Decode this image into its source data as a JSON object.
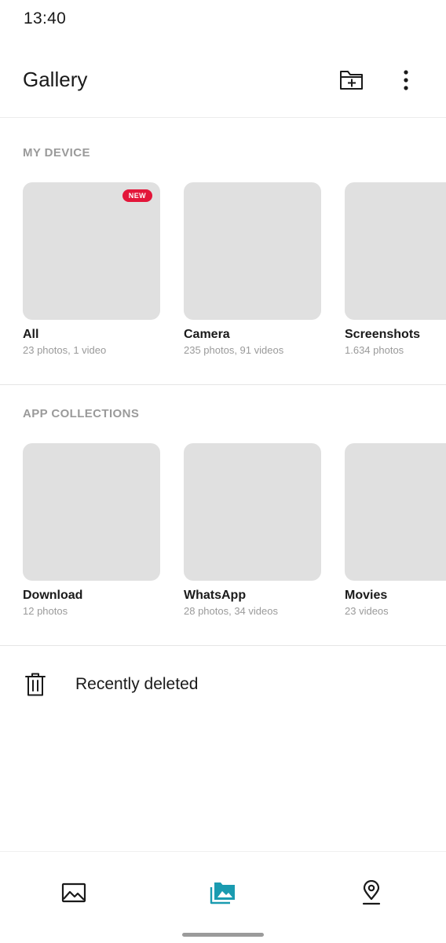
{
  "status_bar": {
    "time": "13:40"
  },
  "app_bar": {
    "title": "Gallery",
    "actions": [
      {
        "name": "new-folder",
        "icon": "folder-plus-icon"
      },
      {
        "name": "more-options",
        "icon": "more-vertical-icon"
      }
    ]
  },
  "sections": {
    "my_device": {
      "header": "MY DEVICE",
      "albums": [
        {
          "name": "All",
          "count": "23 photos, 1 video",
          "badge": "NEW"
        },
        {
          "name": "Camera",
          "count": "235 photos, 91 videos"
        },
        {
          "name": "Screenshots",
          "count": "1.634 photos"
        }
      ]
    },
    "app_collections": {
      "header": "APP COLLECTIONS",
      "albums": [
        {
          "name": "Download",
          "count": "12 photos"
        },
        {
          "name": "WhatsApp",
          "count": "28 photos, 34 videos"
        },
        {
          "name": "Movies",
          "count": "23 videos"
        }
      ]
    }
  },
  "recently_deleted": {
    "label": "Recently deleted",
    "icon": "trash-icon"
  },
  "bottom_nav": {
    "items": [
      {
        "name": "photos",
        "icon": "image-icon",
        "active": false
      },
      {
        "name": "collections",
        "icon": "collections-icon",
        "active": true
      },
      {
        "name": "places",
        "icon": "map-pin-icon",
        "active": false
      }
    ],
    "active_color": "#1a9bb0",
    "inactive_color": "#1a1a1a"
  },
  "colors": {
    "badge": "#e3163a",
    "thumbnail_placeholder": "#e0e0e0",
    "secondary_text": "#9a9a9a"
  }
}
